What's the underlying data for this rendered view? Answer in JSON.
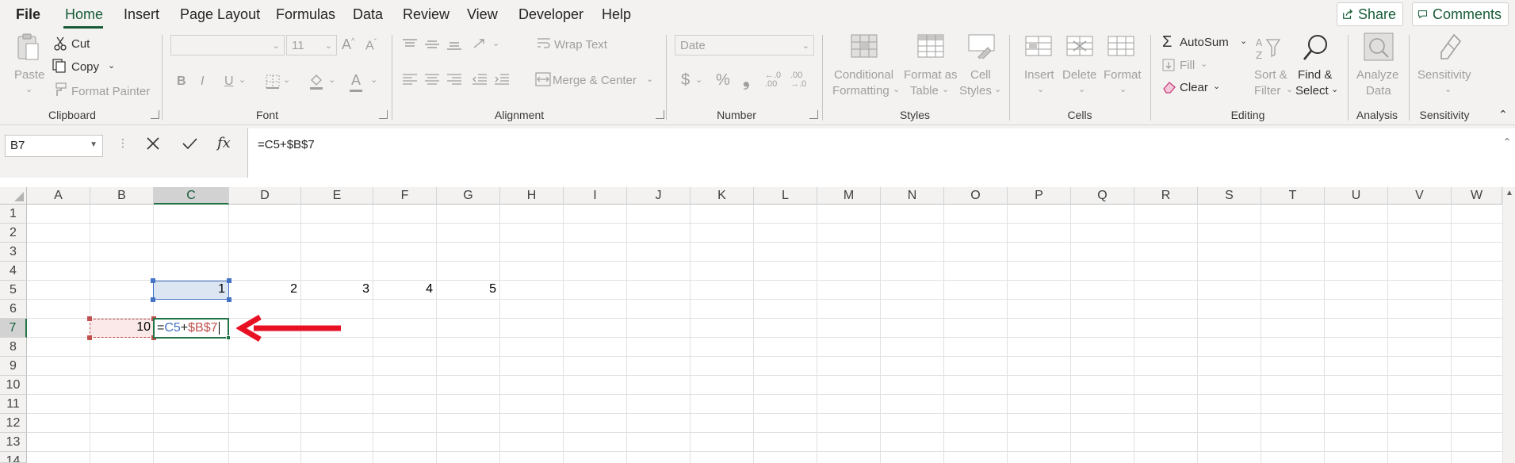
{
  "menu": {
    "tabs": [
      "File",
      "Home",
      "Insert",
      "Page Layout",
      "Formulas",
      "Data",
      "Review",
      "View",
      "Developer",
      "Help"
    ],
    "active": "Home",
    "share_label": "Share",
    "comments_label": "Comments"
  },
  "ribbon": {
    "clipboard": {
      "paste": "Paste",
      "cut": "Cut",
      "copy": "Copy",
      "format_painter": "Format Painter",
      "label": "Clipboard"
    },
    "font": {
      "font_name": "",
      "font_size": "11",
      "bold": "B",
      "italic": "I",
      "underline": "U",
      "label": "Font"
    },
    "alignment": {
      "wrap_text": "Wrap Text",
      "merge_center": "Merge & Center",
      "label": "Alignment"
    },
    "number": {
      "format": "Date",
      "currency": "$",
      "percent": "%",
      "comma": "❟",
      "label": "Number"
    },
    "styles": {
      "conditional_formatting_1": "Conditional",
      "conditional_formatting_2": "Formatting",
      "format_as_table_1": "Format as",
      "format_as_table_2": "Table",
      "cell_styles_1": "Cell",
      "cell_styles_2": "Styles",
      "label": "Styles"
    },
    "cells": {
      "insert": "Insert",
      "delete": "Delete",
      "format": "Format",
      "label": "Cells"
    },
    "editing": {
      "autosum": "AutoSum",
      "fill": "Fill",
      "clear": "Clear",
      "sort_filter_1": "Sort &",
      "sort_filter_2": "Filter",
      "find_select_1": "Find &",
      "find_select_2": "Select",
      "label": "Editing"
    },
    "analysis": {
      "analyze_1": "Analyze",
      "analyze_2": "Data",
      "label": "Analysis"
    },
    "sensitivity": {
      "button": "Sensitivity",
      "label": "Sensitivity"
    }
  },
  "formula_bar": {
    "name_box": "B7",
    "formula": "=C5+$B$7"
  },
  "grid": {
    "columns": [
      "A",
      "B",
      "C",
      "D",
      "E",
      "F",
      "G",
      "H",
      "I",
      "J",
      "K",
      "L",
      "M",
      "N",
      "O",
      "P",
      "Q",
      "R",
      "S",
      "T",
      "U",
      "V",
      "W"
    ],
    "rows": [
      "1",
      "2",
      "3",
      "4",
      "5",
      "6",
      "7",
      "8",
      "9",
      "10",
      "11",
      "12",
      "13",
      "14"
    ],
    "selected_column": "C",
    "selected_row": "7",
    "cells": {
      "C5": "1",
      "D5": "2",
      "E5": "3",
      "F5": "4",
      "G5": "5",
      "B7": "10"
    },
    "editing_cell": {
      "eq": "=",
      "ref1": "C5",
      "plus": "+",
      "ref2": "$B$7"
    }
  },
  "colors": {
    "accent": "#185c37",
    "ref1": "#4472c4",
    "ref2": "#c0504d",
    "arrow": "#e81123"
  }
}
